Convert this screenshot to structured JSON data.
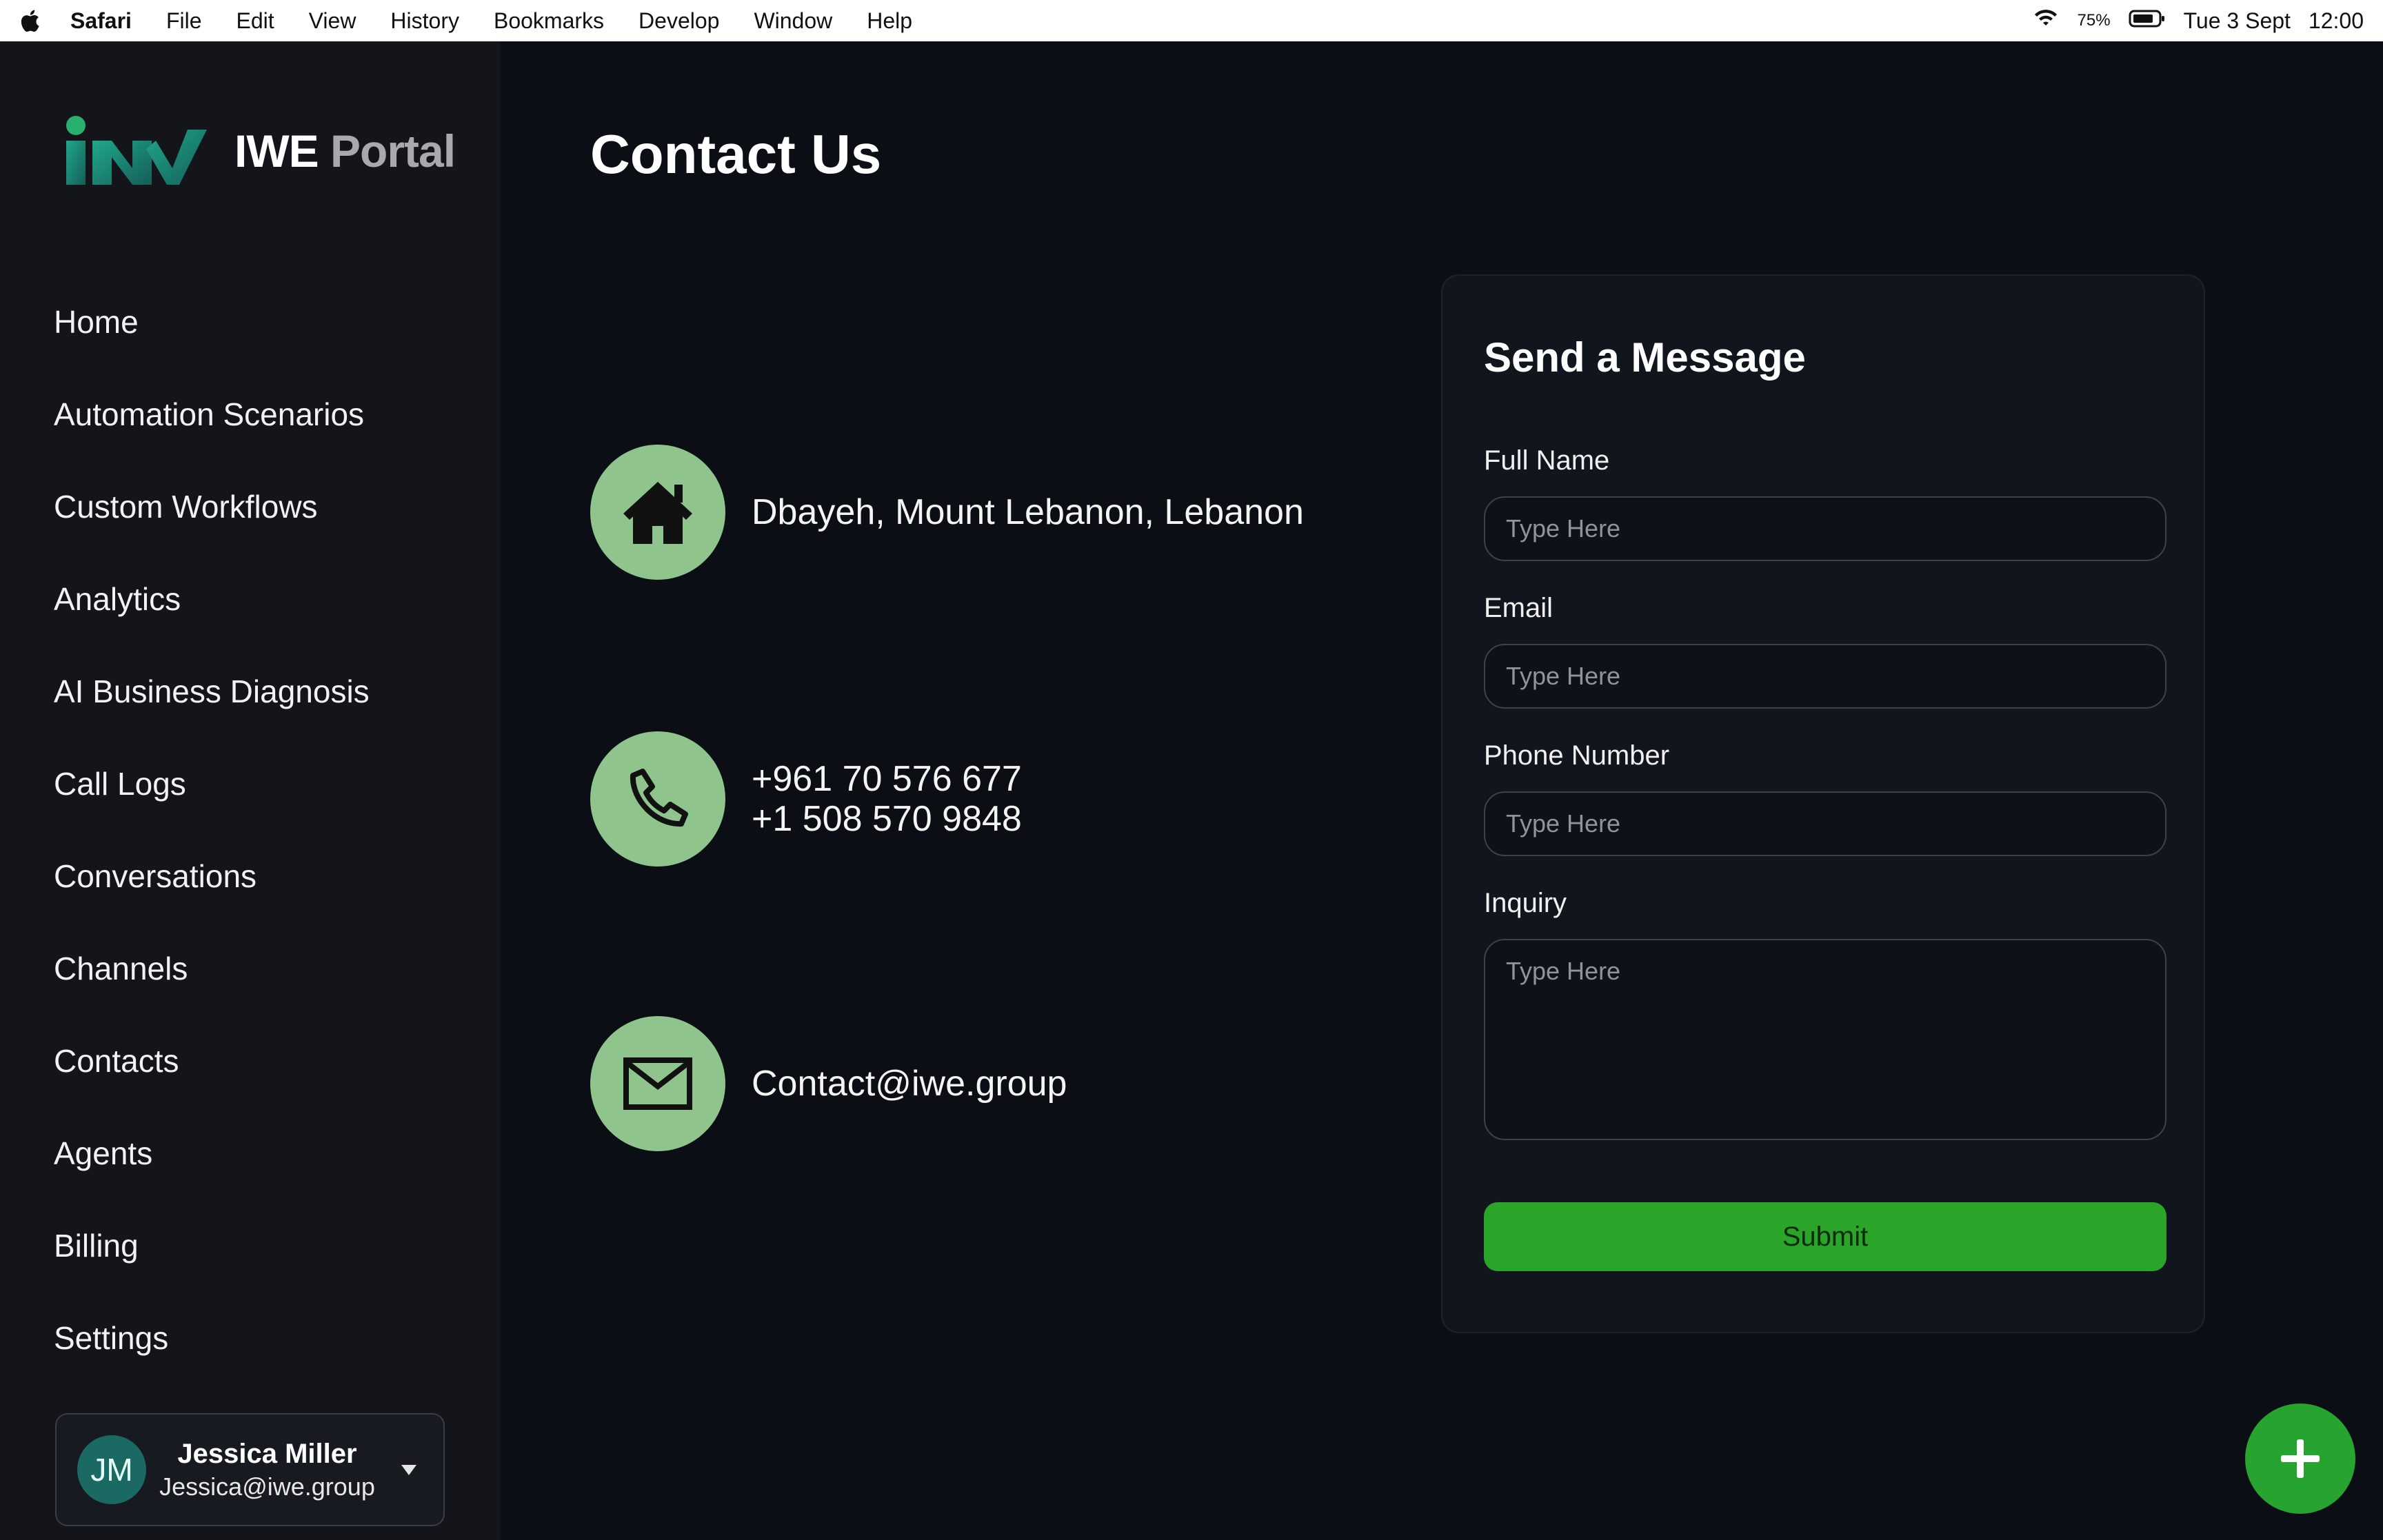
{
  "menubar": {
    "app": "Safari",
    "items": [
      "File",
      "Edit",
      "View",
      "History",
      "Bookmarks",
      "Develop",
      "Window",
      "Help"
    ],
    "battery_pct": "75%",
    "date": "Tue 3 Sept",
    "time": "12:00"
  },
  "brand": {
    "name_part1": "IWE",
    "name_part2": "Portal"
  },
  "nav": [
    {
      "label": "Home"
    },
    {
      "label": "Automation Scenarios"
    },
    {
      "label": "Custom Workflows"
    },
    {
      "label": "Analytics"
    },
    {
      "label": "AI Business Diagnosis"
    },
    {
      "label": "Call Logs"
    },
    {
      "label": "Conversations"
    },
    {
      "label": "Channels"
    },
    {
      "label": "Contacts"
    },
    {
      "label": "Agents"
    },
    {
      "label": "Billing"
    },
    {
      "label": "Settings"
    }
  ],
  "user": {
    "initials": "JM",
    "name": "Jessica Miller",
    "email": "Jessica@iwe.group"
  },
  "page": {
    "title": "Contact Us"
  },
  "contact": {
    "address": "Dbayeh, Mount Lebanon, Lebanon",
    "phone1": "+961 70 576 677",
    "phone2": "+1 508 570 9848",
    "email": "Contact@iwe.group"
  },
  "form": {
    "title": "Send a Message",
    "full_name_label": "Full Name",
    "email_label": "Email",
    "phone_label": "Phone Number",
    "inquiry_label": "Inquiry",
    "placeholder": "Type Here",
    "submit_label": "Submit"
  },
  "colors": {
    "background": "#0b0e14",
    "sidebar": "#13151b",
    "icon_circle": "#8fc58d",
    "accent_green": "#2aa52a",
    "logo_teal": "#1a7a6e"
  }
}
